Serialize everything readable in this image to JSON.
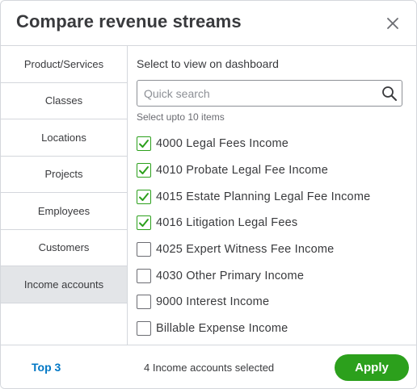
{
  "dialog": {
    "title": "Compare revenue streams"
  },
  "sidebar": {
    "items": [
      {
        "label": "Product/Services"
      },
      {
        "label": "Classes"
      },
      {
        "label": "Locations"
      },
      {
        "label": "Projects"
      },
      {
        "label": "Employees"
      },
      {
        "label": "Customers"
      },
      {
        "label": "Income accounts",
        "active": true
      }
    ]
  },
  "main": {
    "section_title": "Select to view on dashboard",
    "search": {
      "placeholder": "Quick search",
      "value": ""
    },
    "hint": "Select upto 10 items",
    "items": [
      {
        "label": "4000 Legal Fees Income",
        "checked": true
      },
      {
        "label": "4010 Probate Legal Fee Income",
        "checked": true
      },
      {
        "label": "4015 Estate Planning Legal Fee Income",
        "checked": true
      },
      {
        "label": "4016 Litigation Legal Fees",
        "checked": true
      },
      {
        "label": "4025 Expert Witness Fee Income",
        "checked": false
      },
      {
        "label": "4030 Other Primary Income",
        "checked": false
      },
      {
        "label": "9000 Interest Income",
        "checked": false
      },
      {
        "label": "Billable Expense Income",
        "checked": false
      },
      {
        "label": "",
        "checked": false
      }
    ]
  },
  "footer": {
    "top3_label": "Top 3",
    "selected_text": "4 Income accounts selected",
    "apply_label": "Apply"
  },
  "colors": {
    "accent_green": "#2ca01c",
    "link_blue": "#0077c5",
    "active_bg": "#e3e5e8"
  }
}
